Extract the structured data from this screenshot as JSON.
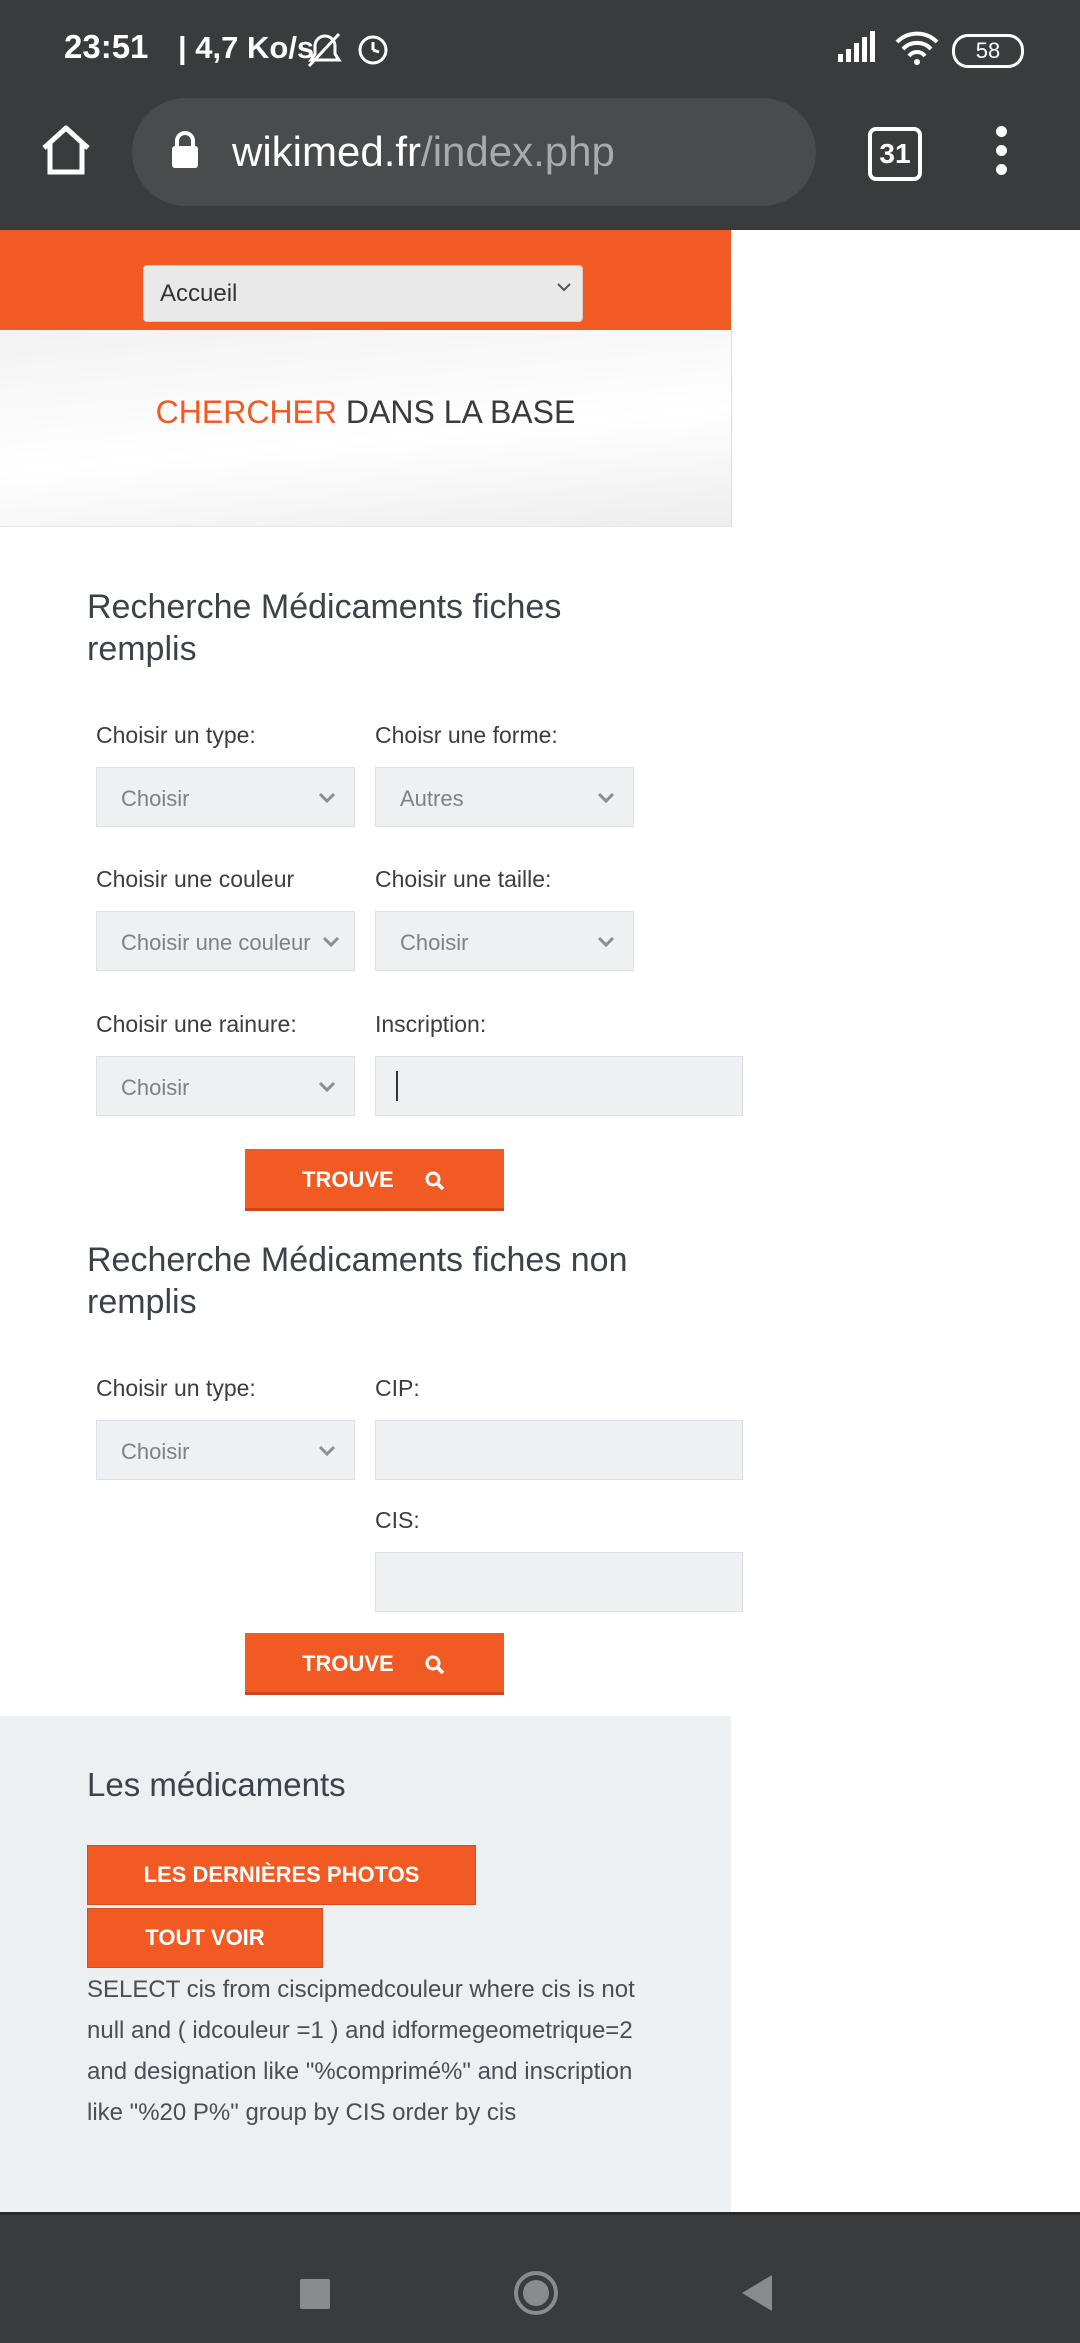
{
  "status": {
    "time": "23:51",
    "speed": "| 4,7 Ko/s",
    "battery": "58"
  },
  "browser": {
    "url_domain": "wikimed.fr",
    "url_path": "/index.php",
    "tab_count": "31"
  },
  "nav": {
    "selected": "Accueil"
  },
  "hero": {
    "title_accent": "CHERCHER",
    "title_rest": " DANS LA BASE"
  },
  "filled_search": {
    "title": "Recherche Médicaments fiches remplis",
    "type_label": "Choisir un type:",
    "type_value": "Choisir",
    "forme_label": "Choisr une forme:",
    "forme_value": "Autres",
    "couleur_label": "Choisir une couleur",
    "couleur_value": "Choisir une couleur",
    "taille_label": "Choisir une taille:",
    "taille_value": "Choisir",
    "rainure_label": "Choisir une rainure:",
    "rainure_value": "Choisir",
    "inscription_label": "Inscription:",
    "inscription_value": "",
    "button": "TROUVE"
  },
  "unfilled_search": {
    "title": "Recherche Médicaments fiches non remplis",
    "type_label": "Choisir un type:",
    "type_value": "Choisir",
    "cip_label": "CIP:",
    "cip_value": "",
    "cis_label": "CIS:",
    "cis_value": "",
    "button": "TROUVE"
  },
  "meds": {
    "title": "Les médicaments",
    "latest_photos_button": "LES DERNIÈRES PHOTOS",
    "see_all_button": "TOUT VOIR",
    "sql_text": "SELECT cis from ciscipmedcouleur where cis is not null and ( idcouleur =1 ) and idformegeometrique=2 and designation like \"%comprimé%\" and inscription like \"%20 P%\" group by CIS order by cis"
  },
  "colors": {
    "accent": "#f15a22",
    "chrome": "#3a3b3d"
  }
}
